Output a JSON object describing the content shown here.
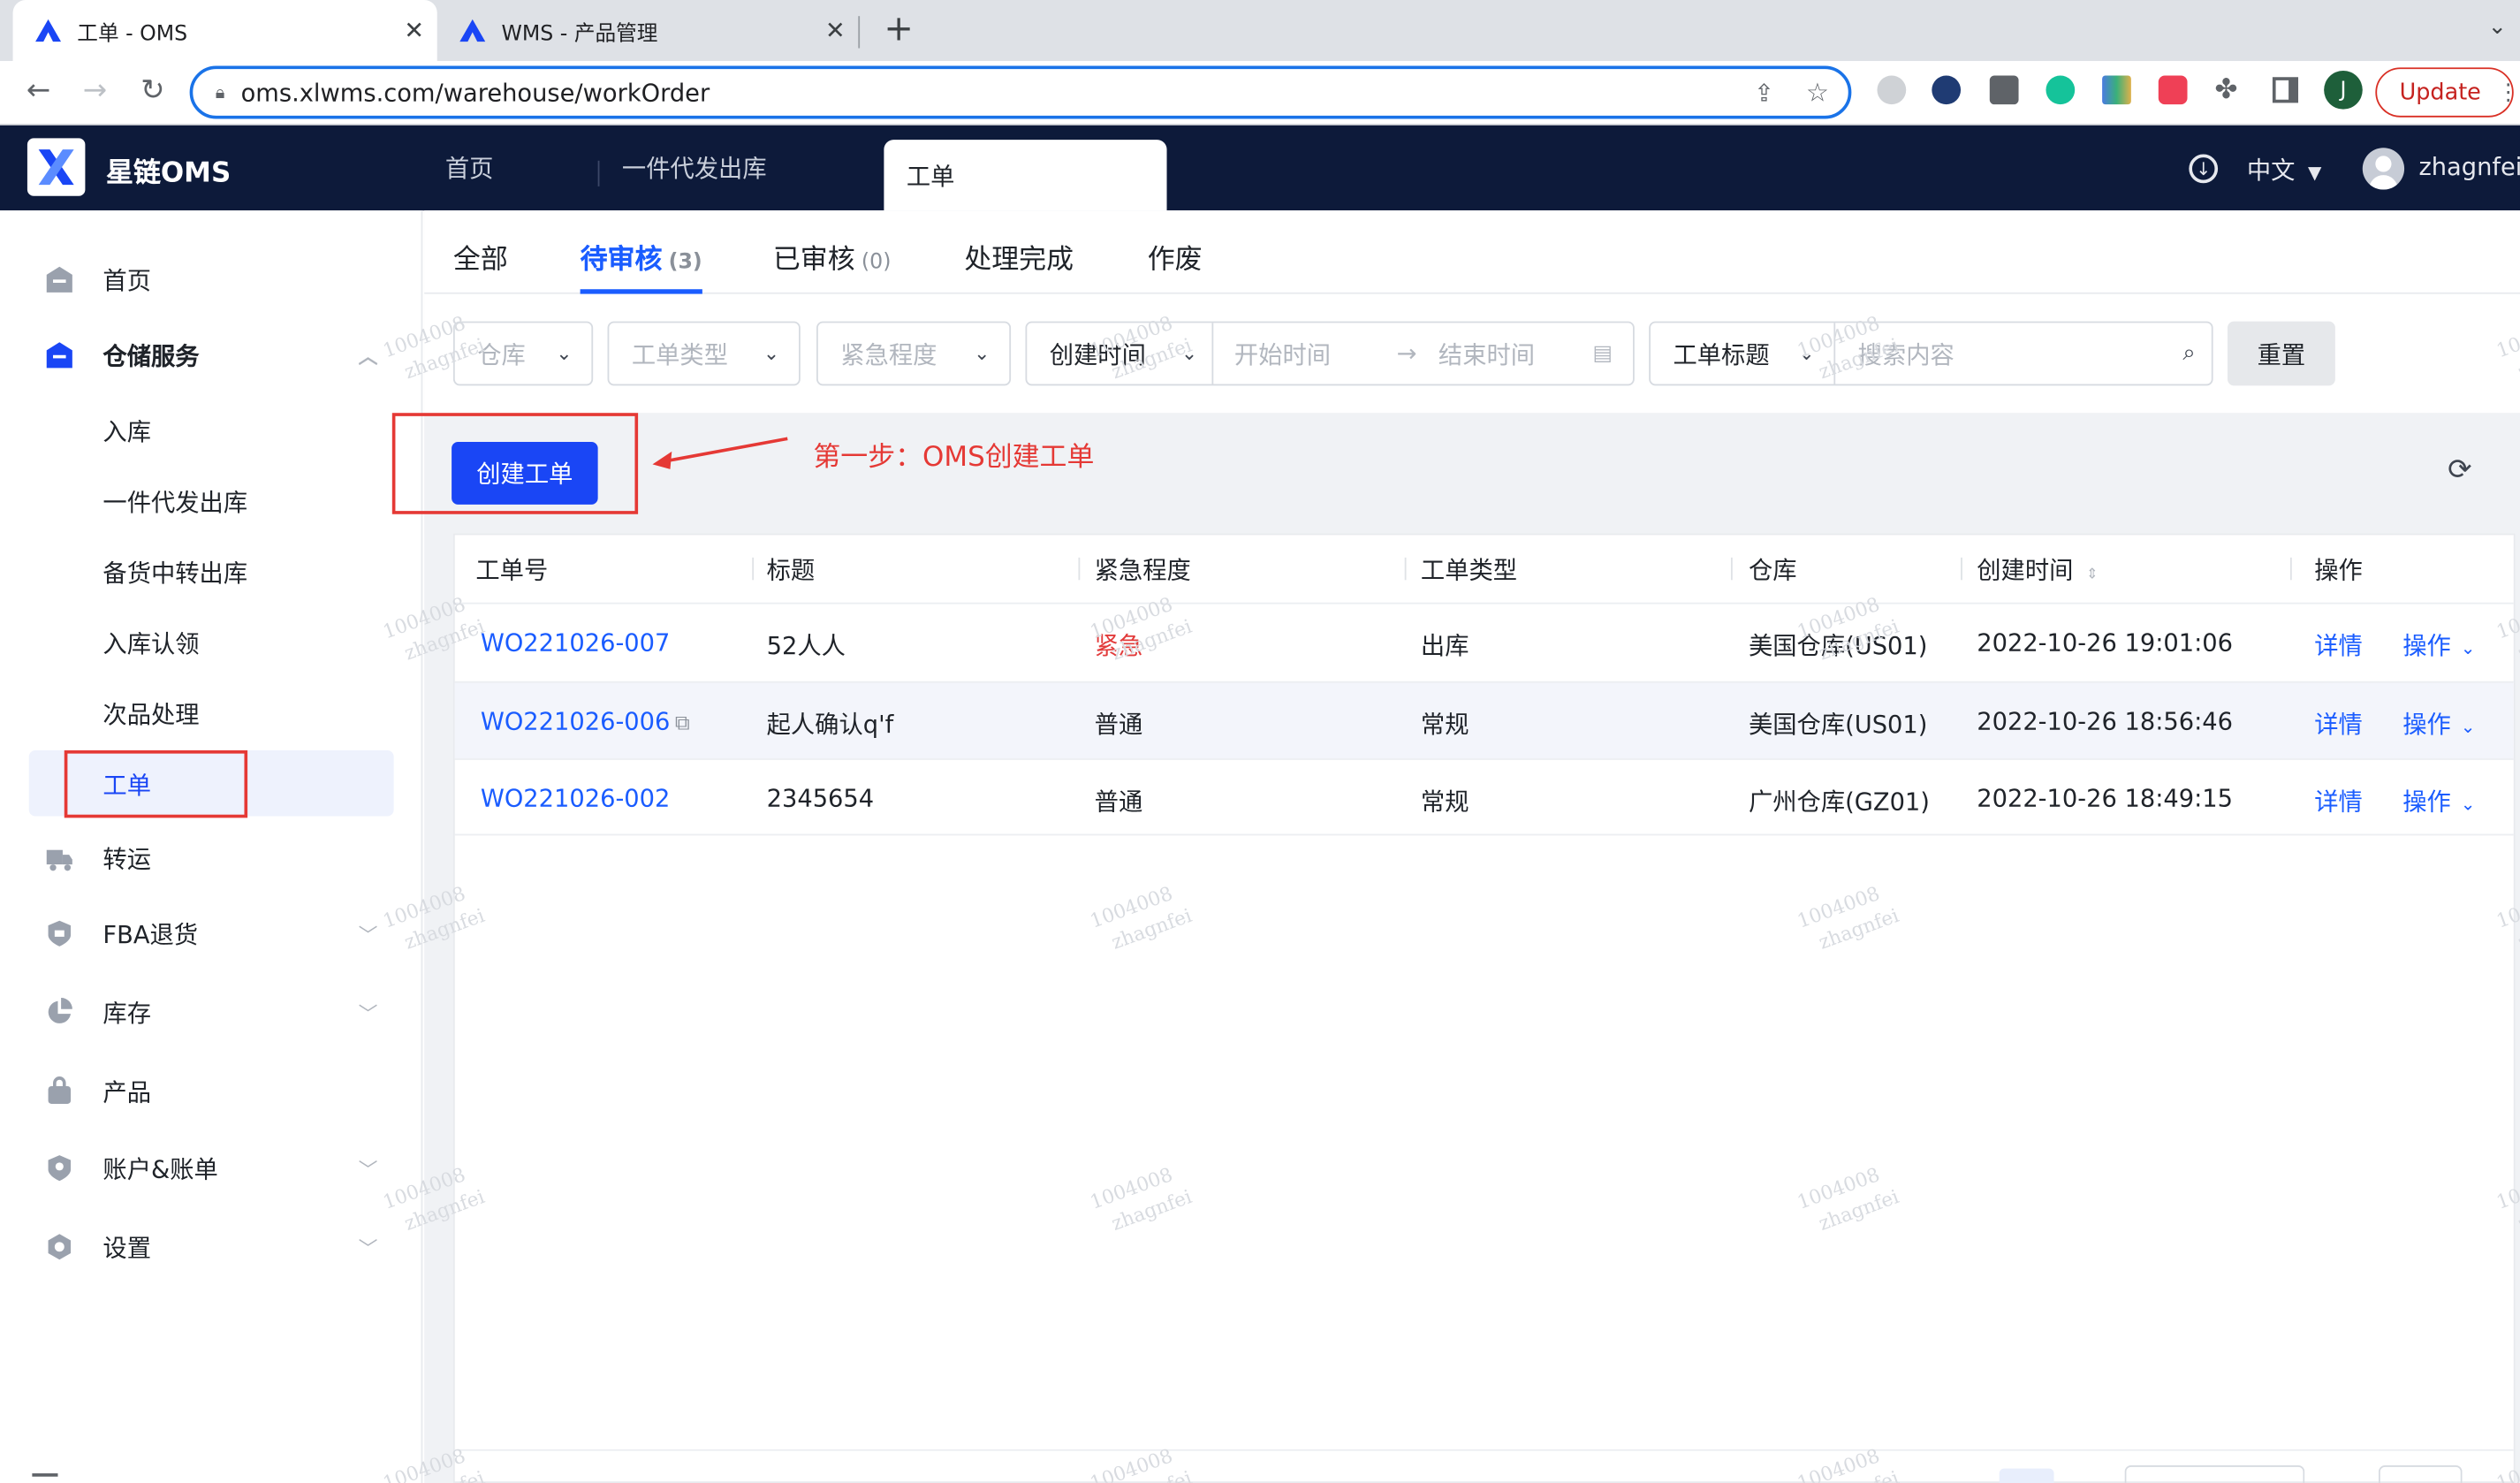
{
  "browser": {
    "tabs": [
      {
        "title": "工单 - OMS",
        "active": true
      },
      {
        "title": "WMS - 产品管理",
        "active": false
      }
    ],
    "url": "oms.xlwms.com/warehouse/workOrder",
    "update_label": "Update",
    "profile_initial": "J"
  },
  "header": {
    "brand": "星链OMS",
    "tabs": [
      "首页",
      "一件代发出库",
      "工单"
    ],
    "active_tab": "工单",
    "language": "中文",
    "username": "zhagnfei"
  },
  "sidebar": {
    "items": [
      {
        "label": "首页",
        "icon": "home-icon"
      },
      {
        "label": "仓储服务",
        "icon": "warehouse-icon",
        "expanded": true
      },
      {
        "label": "转运",
        "icon": "truck-icon"
      },
      {
        "label": "FBA退货",
        "icon": "return-icon"
      },
      {
        "label": "库存",
        "icon": "pie-chart-icon"
      },
      {
        "label": "产品",
        "icon": "bag-icon"
      },
      {
        "label": "账户&账单",
        "icon": "account-icon"
      },
      {
        "label": "设置",
        "icon": "settings-icon"
      }
    ],
    "sub_items": [
      "入库",
      "一件代发出库",
      "备货中转出库",
      "入库认领",
      "次品处理",
      "工单"
    ],
    "selected": "工单"
  },
  "status_tabs": [
    {
      "label": "全部",
      "count": ""
    },
    {
      "label": "待审核",
      "count": "(3)"
    },
    {
      "label": "已审核",
      "count": "(0)"
    },
    {
      "label": "处理完成",
      "count": ""
    },
    {
      "label": "作废",
      "count": ""
    }
  ],
  "active_status_tab": "待审核",
  "filters": {
    "warehouse_placeholder": "仓库",
    "type_placeholder": "工单类型",
    "urgency_placeholder": "紧急程度",
    "time_field": "创建时间",
    "start_placeholder": "开始时间",
    "end_placeholder": "结束时间",
    "search_field": "工单标题",
    "search_placeholder": "搜索内容",
    "reset_label": "重置"
  },
  "create_button_label": "创建工单",
  "annotation": "第一步：OMS创建工单",
  "table": {
    "columns": [
      "工单号",
      "标题",
      "紧急程度",
      "工单类型",
      "仓库",
      "创建时间",
      "操作"
    ],
    "rows": [
      {
        "id": "WO221026-007",
        "title": "52人人",
        "urgency": "紧急",
        "type": "出库",
        "warehouse": "美国仓库(US01)",
        "created": "2022-10-26 19:01:06",
        "detail": "详情",
        "action": "操作"
      },
      {
        "id": "WO221026-006",
        "title": "起人确认q'f",
        "urgency": "普通",
        "type": "常规",
        "warehouse": "美国仓库(US01)",
        "created": "2022-10-26 18:56:46",
        "detail": "详情",
        "action": "操作"
      },
      {
        "id": "WO221026-002",
        "title": "2345654",
        "urgency": "普通",
        "type": "常规",
        "warehouse": "广州仓库(GZ01)",
        "created": "2022-10-26 18:49:15",
        "detail": "详情",
        "action": "操作"
      }
    ]
  },
  "watermark": [
    "1004008",
    "zhagnfei"
  ],
  "colors": {
    "header_bg": "#0d1a3a",
    "primary": "#1a46f5",
    "link": "#1a5cff",
    "urgent": "#e23b3b",
    "annotation": "#e53935"
  }
}
